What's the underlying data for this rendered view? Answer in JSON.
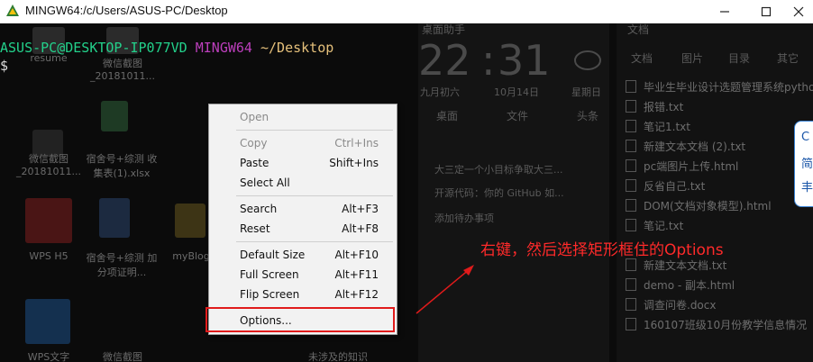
{
  "window": {
    "title": "MINGW64:/c/Users/ASUS-PC/Desktop",
    "buttons": [
      "minimize",
      "maximize",
      "close"
    ]
  },
  "terminal": {
    "user_host": "ASUS-PC@DESKTOP-IP077VD",
    "system": "MINGW64",
    "path": "~/Desktop",
    "prompt_char": "$"
  },
  "desktop_icons": [
    {
      "label": "resume"
    },
    {
      "label": "微信截图 _201810​11..."
    },
    {
      "label": "微信截图 _201810​11..."
    },
    {
      "label": "宿舍号+综测 收集表(1).xlsx"
    },
    {
      "label": "WPS H5"
    },
    {
      "label": "宿舍号+综测 加分项证明..."
    },
    {
      "label": "myBlog"
    },
    {
      "label": "WPS文字"
    },
    {
      "label": "微信截图"
    },
    {
      "label": "未涉及的知识"
    }
  ],
  "widget": {
    "header": "桌面助手",
    "time_hour": "22",
    "time_min": "31",
    "lunar": "九月初六",
    "date": "10月14日",
    "weekday": "星期日",
    "tabs": [
      "桌面",
      "文件",
      "头条"
    ],
    "tasks": [
      "大三定一个小目标争取大三...",
      "开源代码：你的 GitHub 如...",
      "添加待办事项"
    ]
  },
  "file_panel": {
    "header": "文档",
    "tabs": [
      "文档",
      "图片",
      "目录",
      "其它"
    ],
    "files": [
      "毕业生毕业设计选题管理系统python",
      "报错.txt",
      "笔记1.txt",
      "新建文本文档 (2).txt",
      "pc端图片上传.html",
      "反省自己.txt",
      "DOM(文档对象模型).html",
      "笔记.txt",
      "新建文本文档.txt",
      "demo - 副本.html",
      "调查问卷.docx",
      "160107班级10月份教学信息情况"
    ]
  },
  "context_menu": {
    "items": [
      {
        "label": "Open",
        "shortcut": "",
        "disabled": true
      },
      {
        "label": "Copy",
        "shortcut": "Ctrl+Ins",
        "disabled": true
      },
      {
        "label": "Paste",
        "shortcut": "Shift+Ins",
        "disabled": false
      },
      {
        "label": "Select All",
        "shortcut": "",
        "disabled": false
      },
      {
        "label": "Search",
        "shortcut": "Alt+F3",
        "disabled": false
      },
      {
        "label": "Reset",
        "shortcut": "Alt+F8",
        "disabled": false
      },
      {
        "label": "Default Size",
        "shortcut": "Alt+F10",
        "disabled": false
      },
      {
        "label": "Full Screen",
        "shortcut": "Alt+F11",
        "disabled": false
      },
      {
        "label": "Flip Screen",
        "shortcut": "Alt+F12",
        "disabled": false
      },
      {
        "label": "Options...",
        "shortcut": "",
        "disabled": false
      }
    ]
  },
  "annotation": {
    "text": "右键，然后选择矩形框住的Options",
    "color": "#ff2a2a"
  },
  "bubble": {
    "lines": [
      "C",
      "简",
      "丰"
    ]
  }
}
